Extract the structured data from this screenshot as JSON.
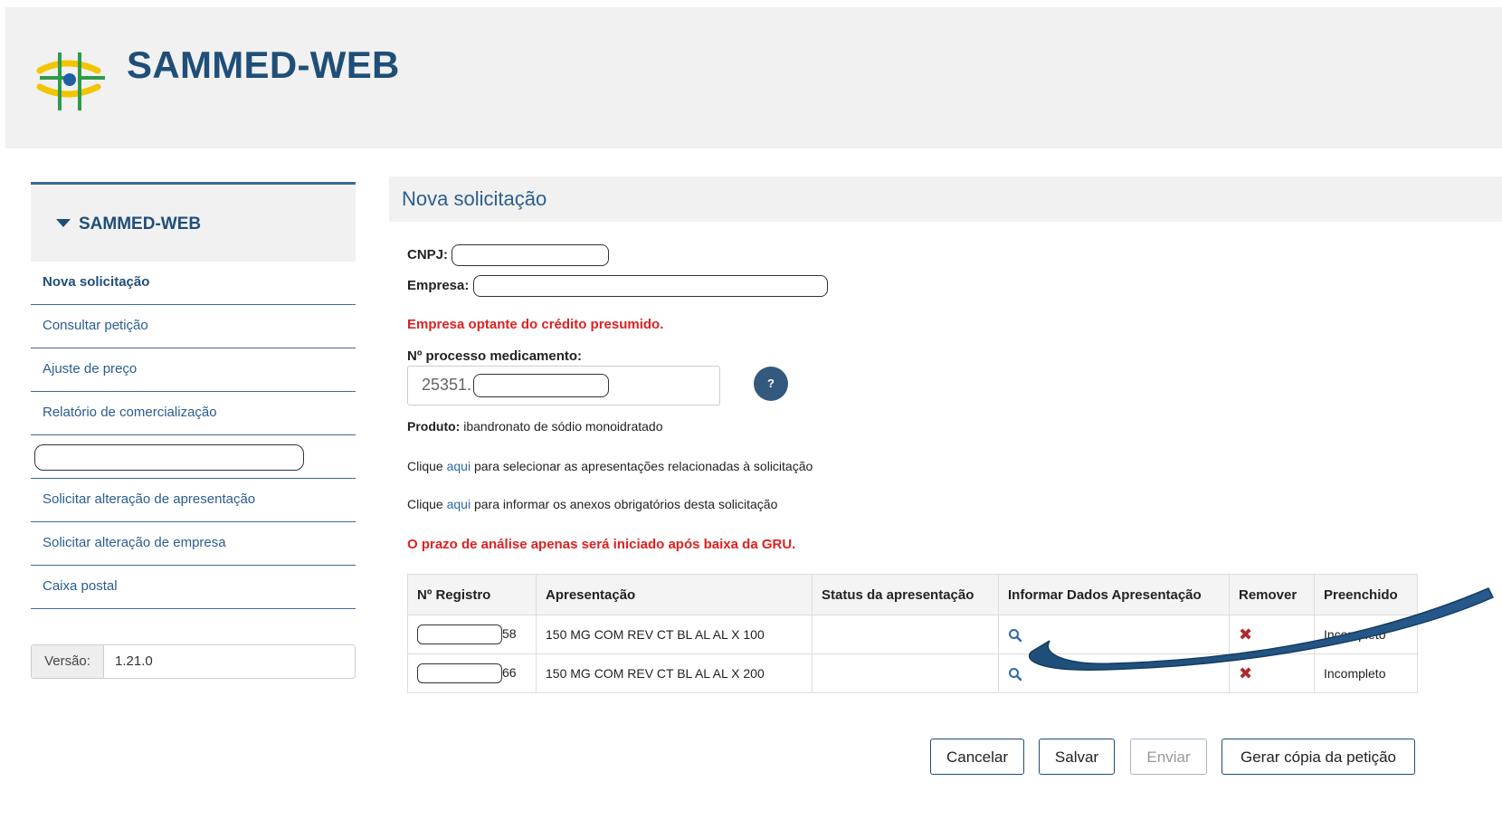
{
  "header": {
    "app_title": "SAMMED-WEB"
  },
  "sidebar": {
    "title": "SAMMED-WEB",
    "items": [
      {
        "label": "Nova solicitação"
      },
      {
        "label": "Consultar petição"
      },
      {
        "label": "Ajuste de preço"
      },
      {
        "label": "Relatório de comercialização"
      },
      {
        "label": ""
      },
      {
        "label": "Solicitar alteração de apresentação"
      },
      {
        "label": "Solicitar alteração de empresa"
      },
      {
        "label": "Caixa postal"
      }
    ],
    "version_label": "Versão:",
    "version_value": "1.21.0"
  },
  "main": {
    "title": "Nova solicitação",
    "cnpj_label": "CNPJ:",
    "empresa_label": "Empresa:",
    "credit_notice": "Empresa optante do crédito presumido.",
    "process_label": "Nº processo medicamento:",
    "process_prefix": "25351.",
    "help_label": "?",
    "product_label": "Produto:",
    "product_value": "ibandronato de sódio monoidratado",
    "click_prefix": "Clique",
    "link_text": "aqui",
    "line1_suffix": "para selecionar as apresentações relacionadas à solicitação",
    "line2_suffix": "para informar os anexos obrigatórios desta solicitação",
    "deadline_notice": "O prazo de análise apenas será iniciado após baixa da GRU."
  },
  "table": {
    "headers": [
      "Nº Registro",
      "Apresentação",
      "Status da apresentação",
      "Informar Dados Apresentação",
      "Remover",
      "Preenchido"
    ],
    "rows": [
      {
        "registro_suffix": "58",
        "apresentacao": "150 MG COM REV CT BL AL AL X 100",
        "status": "",
        "preenchido": "Incompleto"
      },
      {
        "registro_suffix": "66",
        "apresentacao": "150 MG COM REV CT BL AL AL X 200",
        "status": "",
        "preenchido": "Incompleto"
      }
    ]
  },
  "buttons": {
    "cancel": "Cancelar",
    "save": "Salvar",
    "send": "Enviar",
    "copy": "Gerar cópia da petição"
  },
  "icons": {
    "view": "magnifier-icon",
    "remove": "remove-x-icon"
  },
  "colors": {
    "brand": "#1f4e79",
    "link": "#2a6aa8",
    "alert": "#e02020",
    "remove": "#b0282d"
  }
}
